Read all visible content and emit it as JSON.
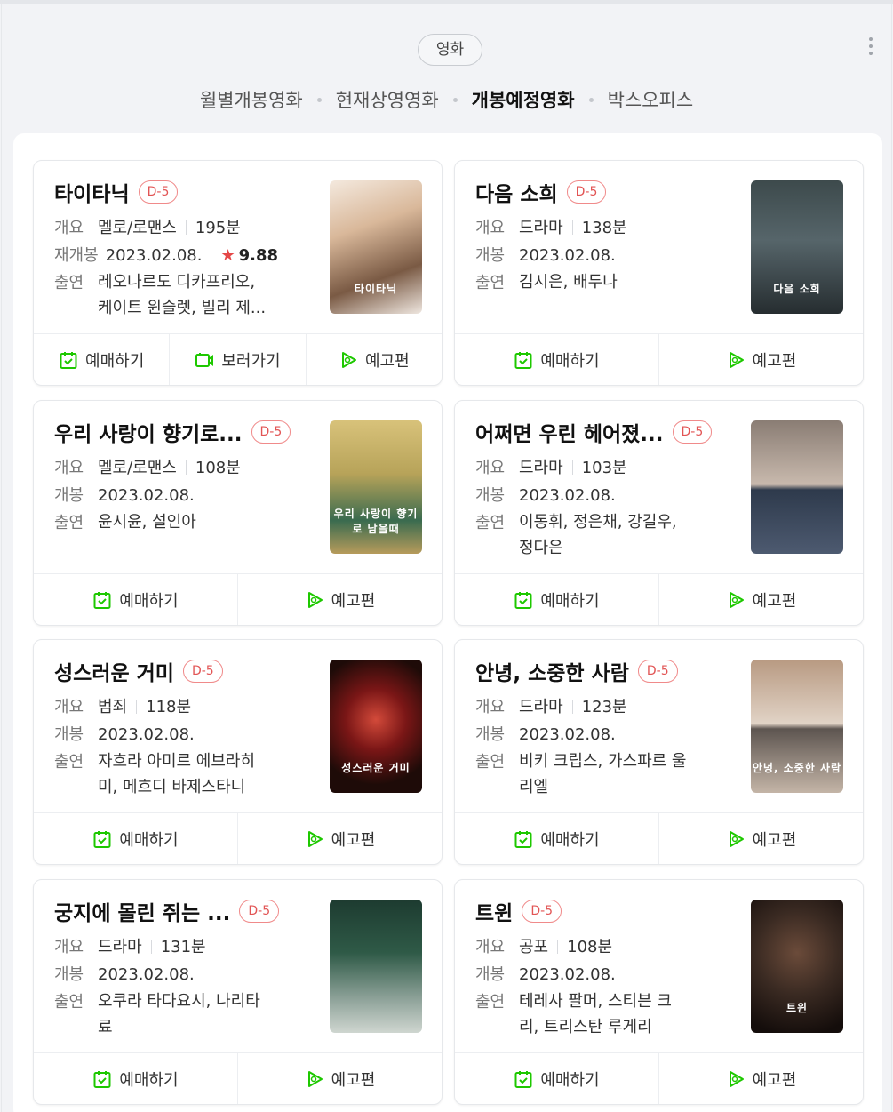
{
  "header": {
    "category": "영화",
    "tabs": [
      {
        "label": "월별개봉영화",
        "active": false
      },
      {
        "label": "현재상영영화",
        "active": false
      },
      {
        "label": "개봉예정영화",
        "active": true
      },
      {
        "label": "박스오피스",
        "active": false
      }
    ]
  },
  "labels": {
    "overview": "개요",
    "release": "개봉",
    "rerelease": "재개봉",
    "cast": "출연",
    "book": "예매하기",
    "watch": "보러가기",
    "trailer": "예고편"
  },
  "colors": {
    "accent_green": "#1ec800",
    "dday_red": "#e25555",
    "star_red": "#e54848"
  },
  "movies": [
    {
      "title": "타이타닉",
      "dday": "D-5",
      "genre": "멜로/로맨스",
      "runtime": "195분",
      "date_label": "재개봉",
      "date": "2023.02.08.",
      "rating": "9.88",
      "cast_line1": "레오나르도 디카프리오,",
      "cast_line2": "케이트 윈슬렛, 빌리 제...",
      "has_watch": true,
      "poster_text": "타이타닉"
    },
    {
      "title": "다음 소희",
      "dday": "D-5",
      "genre": "드라마",
      "runtime": "138분",
      "date_label": "개봉",
      "date": "2023.02.08.",
      "cast_line1": "김시은, 배두나",
      "cast_line2": "",
      "has_watch": false,
      "poster_text": "다음 소희"
    },
    {
      "title": "우리 사랑이 향기로...",
      "dday": "D-5",
      "genre": "멜로/로맨스",
      "runtime": "108분",
      "date_label": "개봉",
      "date": "2023.02.08.",
      "cast_line1": "윤시윤, 설인아",
      "cast_line2": "",
      "has_watch": false,
      "poster_text": "우리 사랑이 향기로 남을때"
    },
    {
      "title": "어쩌면 우린 헤어졌...",
      "dday": "D-5",
      "genre": "드라마",
      "runtime": "103분",
      "date_label": "개봉",
      "date": "2023.02.08.",
      "cast_line1": "이동휘, 정은채, 강길우,",
      "cast_line2": "정다은",
      "has_watch": false,
      "poster_text": ""
    },
    {
      "title": "성스러운 거미",
      "dday": "D-5",
      "genre": "범죄",
      "runtime": "118분",
      "date_label": "개봉",
      "date": "2023.02.08.",
      "cast_line1": "자흐라 아미르 에브라히",
      "cast_line2": "미, 메흐디 바제스타니",
      "has_watch": false,
      "poster_text": "성스러운 거미"
    },
    {
      "title": "안녕, 소중한 사람",
      "dday": "D-5",
      "genre": "드라마",
      "runtime": "123분",
      "date_label": "개봉",
      "date": "2023.02.08.",
      "cast_line1": "비키 크립스, 가스파르 울",
      "cast_line2": "리엘",
      "has_watch": false,
      "poster_text": "안녕, 소중한 사람"
    },
    {
      "title": "궁지에 몰린 쥐는 ...",
      "dday": "D-5",
      "genre": "드라마",
      "runtime": "131분",
      "date_label": "개봉",
      "date": "2023.02.08.",
      "cast_line1": "오쿠라 타다요시, 나리타",
      "cast_line2": "료",
      "has_watch": false,
      "poster_text": ""
    },
    {
      "title": "트윈",
      "dday": "D-5",
      "genre": "공포",
      "runtime": "108분",
      "date_label": "개봉",
      "date": "2023.02.08.",
      "cast_line1": "테레사 팔머, 스티븐 크",
      "cast_line2": "리, 트리스탄 루게리",
      "has_watch": false,
      "poster_text": "트윈"
    }
  ]
}
